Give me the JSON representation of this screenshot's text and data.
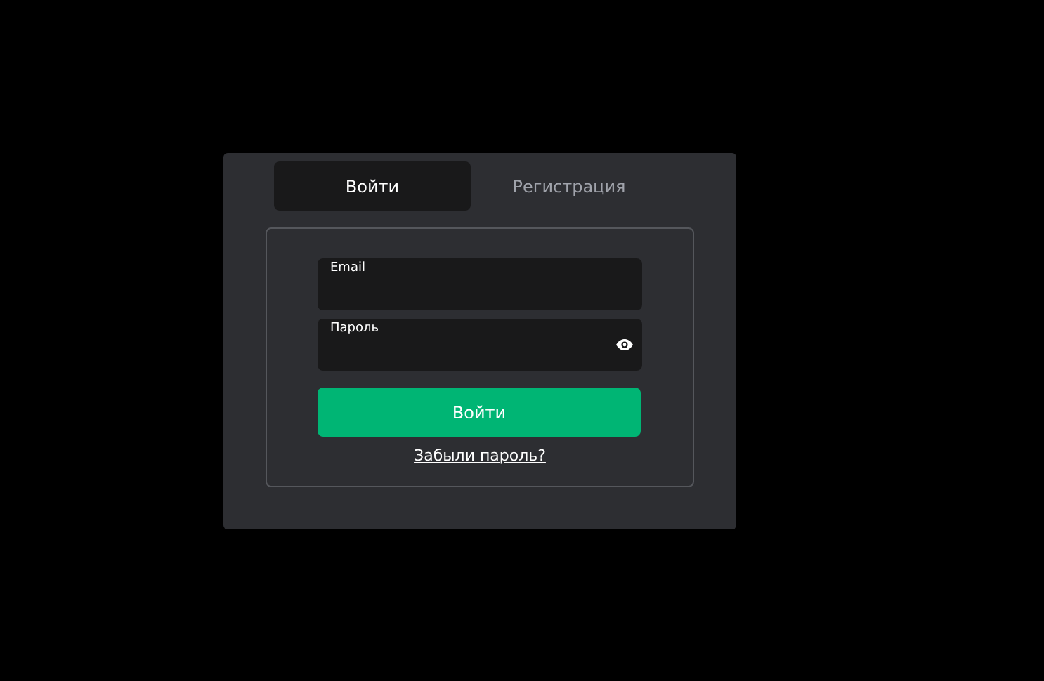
{
  "tabs": [
    {
      "label": "Войти",
      "selected": true
    },
    {
      "label": "Регистрация",
      "selected": false
    }
  ],
  "fields": [
    {
      "label": "Email",
      "password_toggle": false
    },
    {
      "label": "Пароль",
      "password_toggle": true
    }
  ],
  "submit_button": "Войти",
  "forgot_link": "Забыли пароль?"
}
